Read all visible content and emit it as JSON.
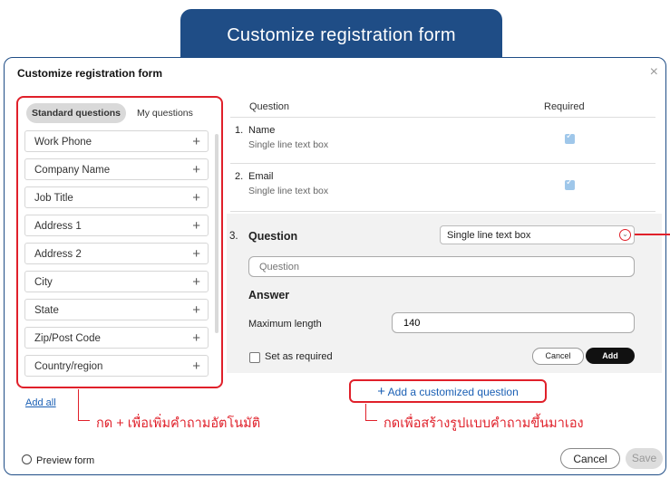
{
  "banner": {
    "title": "Customize registration form"
  },
  "dialog": {
    "title": "Customize registration form",
    "close": "×"
  },
  "tabs": [
    {
      "label": "Standard questions",
      "active": true
    },
    {
      "label": "My questions",
      "active": false
    }
  ],
  "standard_questions": [
    "Work Phone",
    "Company Name",
    "Job Title",
    "Address 1",
    "Address 2",
    "City",
    "State",
    "Zip/Post Code",
    "Country/region"
  ],
  "add_all": "Add all",
  "table": {
    "col_question": "Question",
    "col_required": "Required",
    "rows": [
      {
        "num": "1.",
        "name": "Name",
        "type": "Single line text box",
        "required": true
      },
      {
        "num": "2.",
        "name": "Email",
        "type": "Single line text box",
        "required": true
      }
    ]
  },
  "editor": {
    "num": "3.",
    "label": "Question",
    "type_select": "Single line text box",
    "question_placeholder": "Question",
    "answer_label": "Answer",
    "max_length_label": "Maximum length",
    "max_length_value": "140",
    "set_required_label": "Set as required",
    "cancel": "Cancel",
    "add": "Add"
  },
  "add_custom": {
    "plus": "+",
    "label": "Add a customized question"
  },
  "annotations": {
    "left": "กด + เพื่อเพิ่มคำถามอัตโนมัติ",
    "right": "กดเพื่อสร้างรูปแบบคำถามขึ้นมาเอง"
  },
  "footer": {
    "preview": "Preview form",
    "cancel": "Cancel",
    "save": "Save"
  },
  "colors": {
    "accent": "#1f4d86",
    "highlight": "#e0202a",
    "link": "#1a5fb4"
  }
}
